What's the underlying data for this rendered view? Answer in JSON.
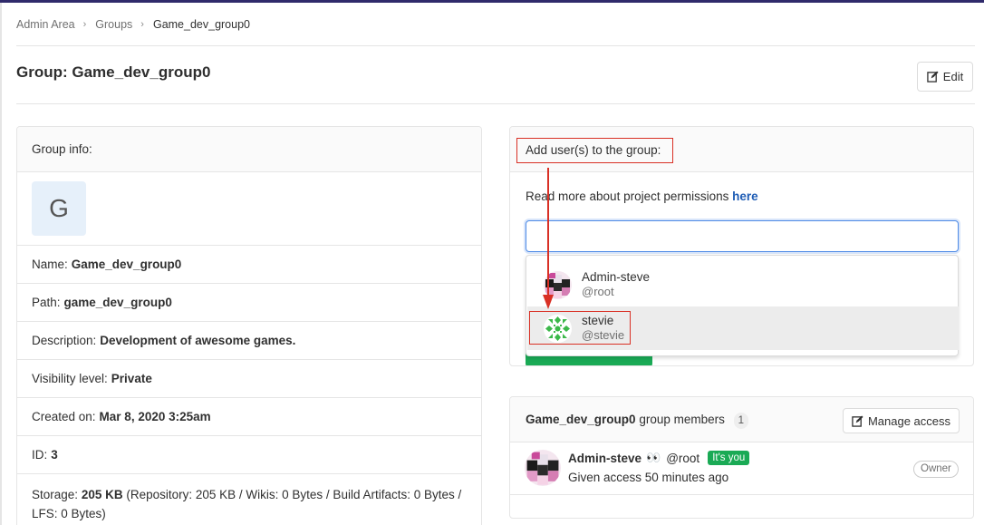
{
  "breadcrumb": {
    "items": [
      "Admin Area",
      "Groups"
    ],
    "current": "Game_dev_group0"
  },
  "page": {
    "title": "Group: Game_dev_group0",
    "edit_label": "Edit"
  },
  "group_info": {
    "header": "Group info:",
    "avatar_letter": "G",
    "rows": [
      {
        "label": "Name:",
        "value": "Game_dev_group0"
      },
      {
        "label": "Path:",
        "value": "game_dev_group0"
      },
      {
        "label": "Description:",
        "value": "Development of awesome games."
      },
      {
        "label": "Visibility level:",
        "value": "Private"
      },
      {
        "label": "Created on:",
        "value": "Mar 8, 2020 3:25am"
      },
      {
        "label": "ID:",
        "value": "3"
      }
    ],
    "storage_label": "Storage:",
    "storage_value": "205 KB",
    "storage_detail_1": "(Repository: 205 KB / Wikis: 0 Bytes / Build Artifacts: 0 Bytes /",
    "storage_detail_2": "LFS: 0 Bytes)"
  },
  "add_users": {
    "header": "Add user(s) to the group:",
    "read_more": "Read more about project permissions",
    "read_more_link": "here",
    "search_value": "",
    "dropdown": [
      {
        "name": "Admin-steve",
        "username": "@root"
      },
      {
        "name": "stevie",
        "username": "@stevie"
      }
    ]
  },
  "members": {
    "group_name": "Game_dev_group0",
    "title_suffix": "group members",
    "count": "1",
    "manage_label": "Manage access",
    "list": [
      {
        "name": "Admin-steve",
        "emoji": "👀",
        "username": "@root",
        "badge": "It's you",
        "access": "Given access 50 minutes ago",
        "role": "Owner"
      }
    ]
  },
  "colors": {
    "accent_blue": "#1f5db5",
    "green": "#1aaa55",
    "annotation_red": "#d93025"
  }
}
